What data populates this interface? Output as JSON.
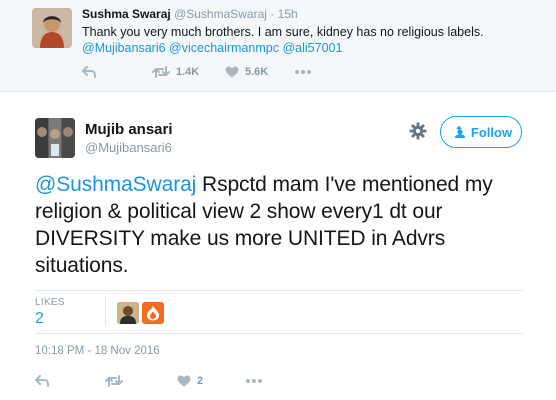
{
  "reply_tweet": {
    "display_name": "Sushma Swaraj",
    "handle": "@SushmaSwaraj",
    "separator": "·",
    "time": "15h",
    "text": "Thank you very much brothers. I am sure, kidney has no religious labels.",
    "mentions": [
      "@Mujibansari6",
      "@vicechairmanmpc",
      "@ali57001"
    ],
    "retweet_count": "1.4K",
    "like_count": "5.6K",
    "icons": [
      "reply-icon",
      "retweet-icon",
      "heart-icon",
      "more-icon"
    ]
  },
  "main_tweet": {
    "display_name": "Mujib ansari",
    "handle": "@Mujibansari6",
    "follow_label": "Follow",
    "mention": "@SushmaSwaraj",
    "text": "Rspctd mam I've mentioned my religion & political view 2 show every1 dt our DIVERSITY make us more UNITED in Advrs situations.",
    "likes_label": "LIKES",
    "likes_count": "2",
    "timestamp": "10:18 PM - 18 Nov 2016",
    "like_action_count": "2",
    "icons": [
      "gear-icon",
      "follow-user-icon",
      "reply-icon",
      "retweet-icon",
      "heart-icon",
      "more-icon"
    ]
  },
  "colors": {
    "accent": "#1da1f2",
    "link": "#1b95e0",
    "muted": "#8899a6",
    "text": "#14171a",
    "panel_bg": "#f5f8fa",
    "border": "#e1e8ed"
  }
}
